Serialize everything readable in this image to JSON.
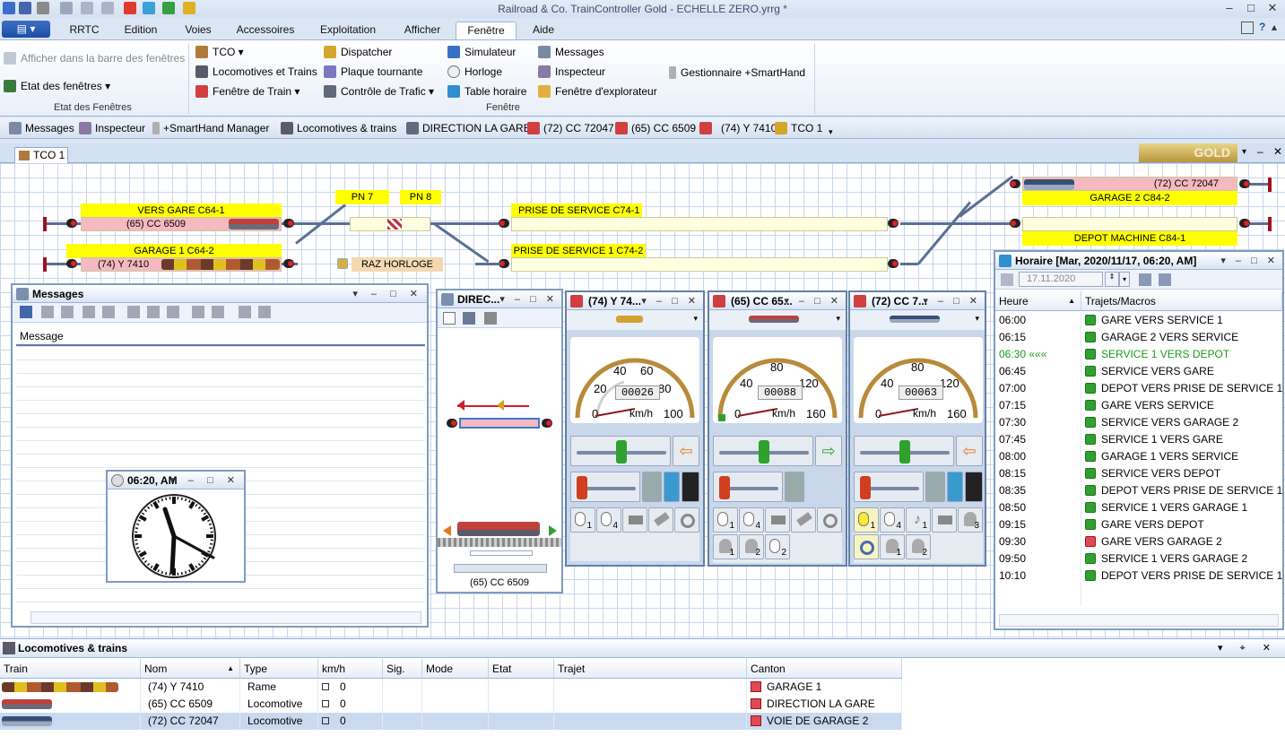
{
  "window": {
    "title": "Railroad & Co. TrainController Gold - ECHELLE ZERO.yrrg *"
  },
  "ribbon_tabs": [
    "RRTC",
    "Edition",
    "Voies",
    "Accessoires",
    "Exploitation",
    "Afficher",
    "Fenêtre",
    "Aide"
  ],
  "ribbon": {
    "group1": {
      "items": [
        "Afficher dans la barre des fenêtres",
        "Etat des fenêtres"
      ],
      "label": "Etat des Fenêtres"
    },
    "group2": {
      "col1": [
        "TCO",
        "Locomotives et Trains",
        "Fenêtre de Train"
      ],
      "col2": [
        "Dispatcher",
        "Plaque tournante",
        "Contrôle de Trafic"
      ],
      "col3": [
        "Simulateur",
        "Horloge",
        "Table horaire"
      ],
      "col4": [
        "Messages",
        "Inspecteur",
        "Fenêtre d'explorateur"
      ],
      "col5": [
        "Gestionnaire +SmartHand"
      ],
      "label": "Fenêtre"
    }
  },
  "quickbar": [
    "Messages",
    "Inspecteur",
    "+SmartHand Manager",
    "Locomotives & trains",
    "DIRECTION LA GARE",
    "(72) CC 72047",
    "(65) CC 6509",
    "(74) Y 7410",
    "TCO 1"
  ],
  "doc_tab": "TCO 1",
  "gold_badge": "GOLD",
  "tco": {
    "labels": {
      "vers_gare": "VERS GARE  C64-1",
      "cc6509": "(65) CC 6509",
      "garage1": "GARAGE 1  C64-2",
      "y7410": "(74) Y 7410",
      "pn7": "PN 7",
      "pn8": "PN 8",
      "raz": "RAZ HORLOGE",
      "prise1": "PRISE DE SERVICE  C74-1",
      "prise2": "PRISE DE SERVICE 1  C74-2",
      "cc72047": "(72) CC 72047",
      "garage2": "GARAGE 2  C84-2",
      "depot": "DEPOT MACHINE  C84-1"
    }
  },
  "messages": {
    "title": "Messages",
    "column": "Message"
  },
  "clock": {
    "title": "06:20, AM"
  },
  "dispatcher": {
    "title": "DIREC...",
    "train": "(65) CC 6509"
  },
  "cabs": [
    {
      "title": "(74) Y 74...",
      "odometer": "00026",
      "unit": "km/h",
      "ticks": [
        "0",
        "20",
        "40",
        "60",
        "80",
        "100"
      ],
      "arrow": "left"
    },
    {
      "title": "(65) CC 65...",
      "odometer": "00088",
      "unit": "km/h",
      "ticks": [
        "0",
        "40",
        "80",
        "120",
        "160"
      ],
      "arrow": "right"
    },
    {
      "title": "(72) CC 7...",
      "odometer": "00063",
      "unit": "km/h",
      "ticks": [
        "0",
        "40",
        "80",
        "120",
        "160"
      ],
      "arrow": "left"
    }
  ],
  "cab_fn_labels": {
    "cab1": [
      "1",
      "4"
    ],
    "cab2": [
      "1",
      "4",
      "1",
      "2",
      "2"
    ],
    "cab3": [
      "1",
      "4",
      "1",
      "3",
      "1",
      "2"
    ]
  },
  "horaire": {
    "title": "Horaire [Mar, 2020/11/17, 06:20, AM]",
    "date": "17.11.2020",
    "col_time": "Heure",
    "col_trips": "Trajets/Macros",
    "rows": [
      {
        "time": "06:00",
        "trip": "GARE VERS SERVICE 1",
        "icon": "green"
      },
      {
        "time": "06:15",
        "trip": "GARAGE 2 VERS SERVICE",
        "icon": "green"
      },
      {
        "time": "06:30 «««",
        "trip": "SERVICE 1 VERS DEPOT",
        "icon": "green",
        "active": true
      },
      {
        "time": "06:45",
        "trip": "SERVICE VERS GARE",
        "icon": "green"
      },
      {
        "time": "07:00",
        "trip": "DEPOT VERS PRISE DE SERVICE 1",
        "icon": "green"
      },
      {
        "time": "07:15",
        "trip": "GARE VERS SERVICE",
        "icon": "green"
      },
      {
        "time": "07:30",
        "trip": "SERVICE VERS GARAGE 2",
        "icon": "green"
      },
      {
        "time": "07:45",
        "trip": "SERVICE 1 VERS GARE",
        "icon": "green"
      },
      {
        "time": "08:00",
        "trip": "GARAGE 1 VERS SERVICE",
        "icon": "green"
      },
      {
        "time": "08:15",
        "trip": "SERVICE VERS DEPOT",
        "icon": "green"
      },
      {
        "time": "08:35",
        "trip": "DEPOT VERS PRISE DE SERVICE 1",
        "icon": "green"
      },
      {
        "time": "08:50",
        "trip": "SERVICE 1 VERS GARAGE 1",
        "icon": "green"
      },
      {
        "time": "09:15",
        "trip": "GARE VERS DEPOT",
        "icon": "green"
      },
      {
        "time": "09:30",
        "trip": "GARE VERS GARAGE 2",
        "icon": "red"
      },
      {
        "time": "09:50",
        "trip": "SERVICE 1 VERS GARAGE 2",
        "icon": "green"
      },
      {
        "time": "10:10",
        "trip": "DEPOT VERS PRISE DE SERVICE 1",
        "icon": "green"
      }
    ]
  },
  "locos": {
    "title": "Locomotives & trains",
    "columns": [
      "Train",
      "Nom",
      "Type",
      "km/h",
      "Sig.",
      "Mode",
      "Etat",
      "Trajet",
      "Canton"
    ],
    "rows": [
      {
        "nom": "(74) Y 7410",
        "type": "Rame",
        "kmh": "0",
        "canton": "GARAGE 1"
      },
      {
        "nom": "(65) CC 6509",
        "type": "Locomotive",
        "kmh": "0",
        "canton": "DIRECTION LA GARE"
      },
      {
        "nom": "(72) CC 72047",
        "type": "Locomotive",
        "kmh": "0",
        "canton": "VOIE DE GARAGE 2"
      }
    ]
  }
}
